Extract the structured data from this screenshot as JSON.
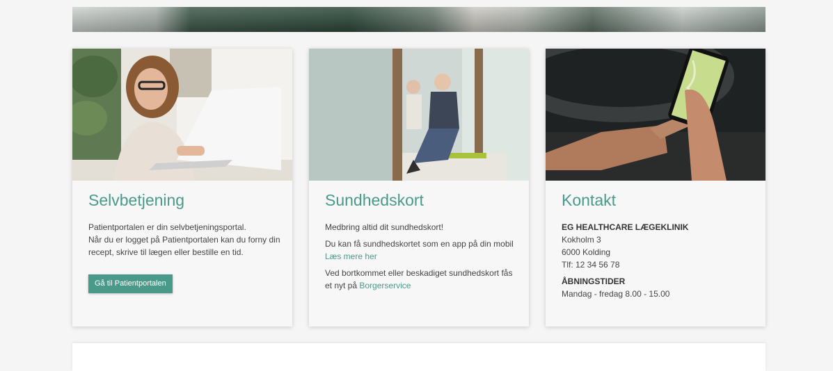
{
  "cards": [
    {
      "title": "Selvbetjening",
      "lines": [
        "Patientportalen er din selvbetjeningsportal.",
        "Når du er logget på Patientportalen kan du forny din recept, skrive til lægen eller bestille en tid."
      ],
      "button_label": "Gå til Patientportalen"
    },
    {
      "title": "Sundhedskort",
      "p1": "Medbring altid dit sundhedskort!",
      "p2_text": "Du kan få sundhedskortet som en app på din mobil",
      "p2_link": "Læs mere her",
      "p3_text": "Ved bortkommet eller beskadiget sundhedskort fås et nyt på",
      "p3_link": "Borgerservice"
    },
    {
      "title": "Kontakt",
      "clinic_name": "EG HEALTHCARE LÆGEKLINIK",
      "address_street": "Kokholm 3",
      "address_city": "6000 Kolding",
      "phone": "Tlf: 12 34 56 78",
      "hours_heading": "ÅBNINGSTIDER",
      "hours": "Mandag - fredag 8.00 - 15.00"
    }
  ],
  "colors": {
    "accent": "#4a9a8a",
    "background": "#f5f5f5",
    "card": "#f7f7f7"
  }
}
